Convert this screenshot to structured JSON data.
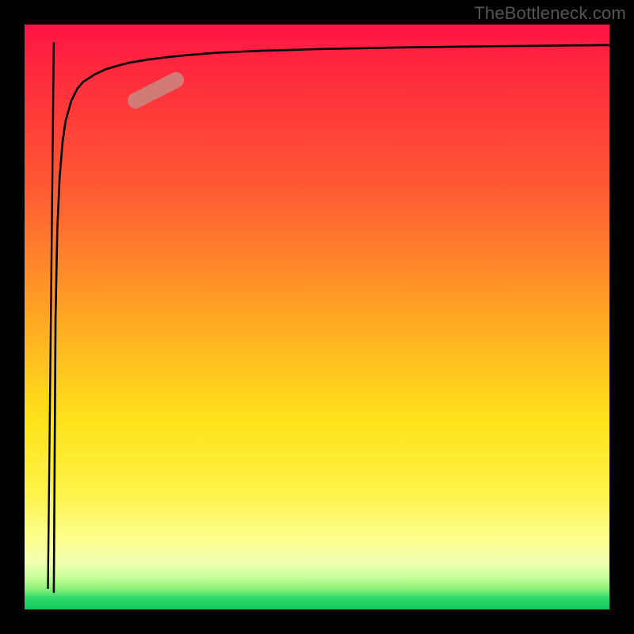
{
  "watermark": "TheBottleneck.com",
  "chart_data": {
    "type": "line",
    "title": "",
    "xlabel": "",
    "ylabel": "",
    "xlim": [
      0,
      100
    ],
    "ylim": [
      0,
      100
    ],
    "grid": false,
    "series": [
      {
        "name": "curve",
        "x": [
          5.0,
          5.3,
          5.6,
          6.0,
          6.5,
          7.0,
          8.0,
          9.0,
          10.0,
          12.0,
          14.0,
          16.0,
          18.0,
          21.0,
          24.0,
          28.0,
          33.0,
          40.0,
          50.0,
          65.0,
          80.0,
          100.0
        ],
        "y": [
          97.0,
          50.0,
          35.0,
          26.0,
          20.0,
          16.5,
          13.0,
          11.0,
          9.8,
          8.5,
          7.6,
          7.0,
          6.5,
          6.0,
          5.6,
          5.2,
          4.8,
          4.5,
          4.2,
          3.9,
          3.7,
          3.5
        ]
      },
      {
        "name": "spike",
        "x": [
          4.0,
          4.5,
          5.0
        ],
        "y": [
          3.5,
          50.0,
          97.0
        ]
      }
    ],
    "highlight": {
      "name": "marker-segment",
      "x_range": [
        19.0,
        26.0
      ],
      "y_range": [
        8.6,
        12.0
      ]
    },
    "background_gradient": {
      "top": "#ff1445",
      "mid_upper": "#ff8a2a",
      "mid": "#ffe31a",
      "mid_lower": "#fbff8f",
      "bottom": "#12c85e"
    }
  }
}
